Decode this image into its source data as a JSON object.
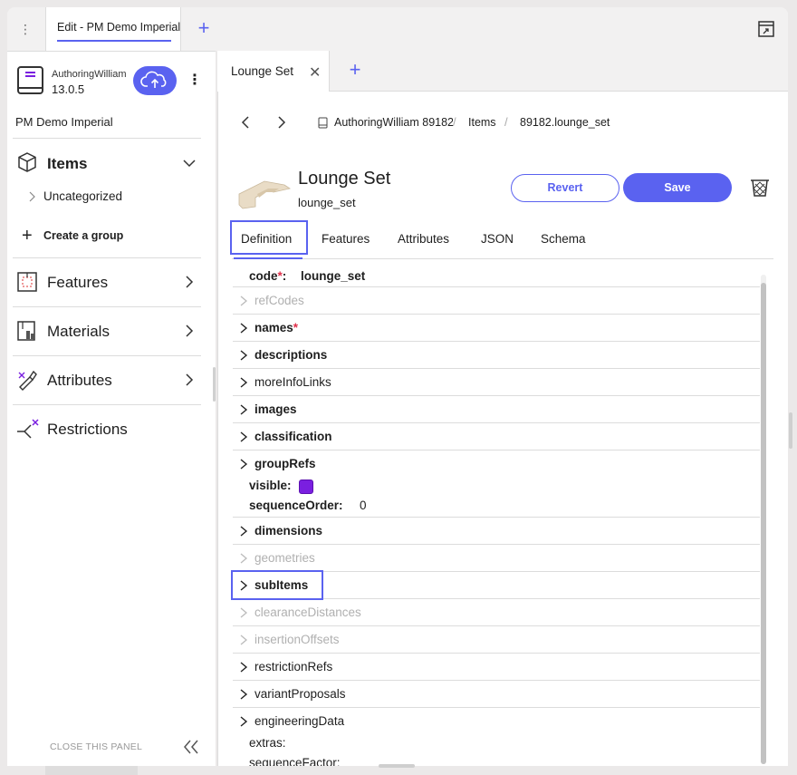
{
  "window": {
    "tab_title": "Edit - PM Demo Imperial"
  },
  "left_panel": {
    "user": "AuthoringWilliam",
    "version": "13.0.5",
    "catalog_name": "PM Demo Imperial",
    "items_section": {
      "label": "Items",
      "children": [
        "Uncategorized"
      ],
      "create_group": "Create a group"
    },
    "nav": [
      {
        "label": "Features"
      },
      {
        "label": "Materials"
      },
      {
        "label": "Attributes"
      },
      {
        "label": "Restrictions"
      }
    ],
    "close_panel": "CLOSE THIS PANEL"
  },
  "editor": {
    "tab_label": "Lounge Set",
    "breadcrumb": [
      "AuthoringWilliam 89182",
      "Items",
      "89182.lounge_set"
    ],
    "title": "Lounge Set",
    "code": "lounge_set",
    "buttons": {
      "revert": "Revert",
      "save": "Save"
    },
    "tabs": [
      "Definition",
      "Features",
      "Attributes",
      "JSON",
      "Schema"
    ],
    "active_tab": "Definition",
    "code_row": {
      "key": "code",
      "required": "*",
      "colon": ":",
      "value": "lounge_set"
    },
    "properties": [
      {
        "label": "refCodes"
      },
      {
        "label": "names",
        "required": "*"
      },
      {
        "label": "descriptions"
      },
      {
        "label": "moreInfoLinks"
      },
      {
        "label": "images"
      },
      {
        "label": "classification"
      },
      {
        "label": "groupRefs"
      },
      {
        "label": "dimensions"
      },
      {
        "label": "geometries"
      },
      {
        "label": "subItems"
      },
      {
        "label": "clearanceDistances"
      },
      {
        "label": "insertionOffsets"
      },
      {
        "label": "restrictionRefs"
      },
      {
        "label": "variantProposals"
      },
      {
        "label": "engineeringData"
      }
    ],
    "fields": {
      "visible_label": "visible:",
      "visible_checked": true,
      "sequence_order_label": "sequenceOrder:",
      "sequence_order_value": "0",
      "extras_label": "extras:",
      "sequence_factor_label": "sequenceFactor:"
    }
  },
  "colors": {
    "accent": "#5a62f0",
    "required": "#e0304a",
    "checkbox": "#7a1fe0",
    "muted_text": "#b0b0b0"
  }
}
